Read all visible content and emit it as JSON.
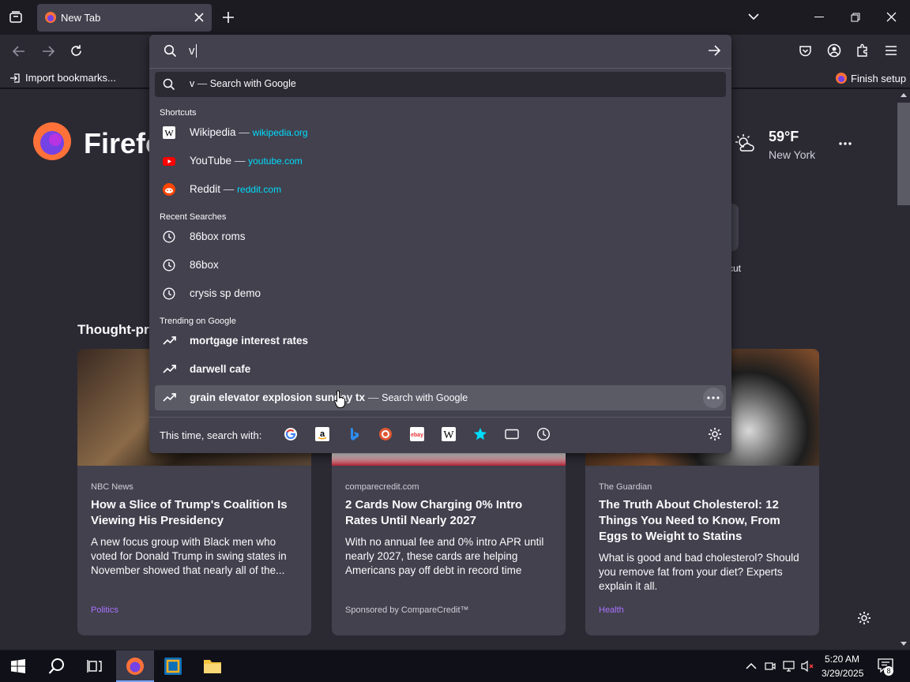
{
  "tab": {
    "title": "New Tab"
  },
  "bookmarks": {
    "import_label": "Import bookmarks...",
    "finish_label": "Finish setup"
  },
  "urlbar": {
    "value": "v"
  },
  "dropdown": {
    "heuristic": {
      "query": "v",
      "sep": "—",
      "action": "Search with Google"
    },
    "shortcuts_header": "Shortcuts",
    "shortcuts": [
      {
        "label": "Wikipedia",
        "sep": "—",
        "url": "wikipedia.org",
        "icon": "wikipedia-icon"
      },
      {
        "label": "YouTube",
        "sep": "—",
        "url": "youtube.com",
        "icon": "youtube-icon"
      },
      {
        "label": "Reddit",
        "sep": "—",
        "url": "reddit.com",
        "icon": "reddit-icon"
      }
    ],
    "recent_header": "Recent Searches",
    "recent": [
      {
        "label": "86box roms"
      },
      {
        "label": "86box"
      },
      {
        "label": "crysis sp demo"
      }
    ],
    "trending_header": "Trending on Google",
    "trending": [
      {
        "label": "mortgage interest rates"
      },
      {
        "label": "darwell cafe"
      },
      {
        "label": "grain elevator explosion sunday tx",
        "sep": "—",
        "action": "Search with Google"
      }
    ],
    "search_with_label": "This time, search with:"
  },
  "newtab": {
    "brand": "Firefo",
    "weather": {
      "temp": "59°F",
      "city": "New York"
    },
    "shortcut_partial": "cut",
    "section_title": "Thought-pro",
    "cards": [
      {
        "source": "NBC News",
        "title": "How a Slice of Trump's Coalition Is Viewing His Presidency",
        "desc": "A new focus group with Black men who voted for Donald Trump in swing states in November showed that nearly all of the...",
        "tag": "Politics"
      },
      {
        "source": "comparecredit.com",
        "title": "2 Cards Now Charging 0% Intro Rates Until Nearly 2027",
        "desc": "With no annual fee and 0% intro APR until nearly 2027, these cards are helping Americans pay off debt in record time",
        "sponsor": "Sponsored by CompareCredit™"
      },
      {
        "source": "The Guardian",
        "title": "The Truth About Cholesterol: 12 Things You Need to Know, From Eggs to Weight to Statins",
        "desc": "What is good and bad cholesterol? Should you remove fat from your diet? Experts explain it all.",
        "tag": "Health"
      }
    ]
  },
  "taskbar": {
    "time": "5:20 AM",
    "date": "3/29/2025",
    "notif_count": "8"
  },
  "colors": {
    "accent": "#00ddff",
    "tag": "#ab71ff",
    "panel": "#42414d",
    "bg": "#2b2a33"
  }
}
